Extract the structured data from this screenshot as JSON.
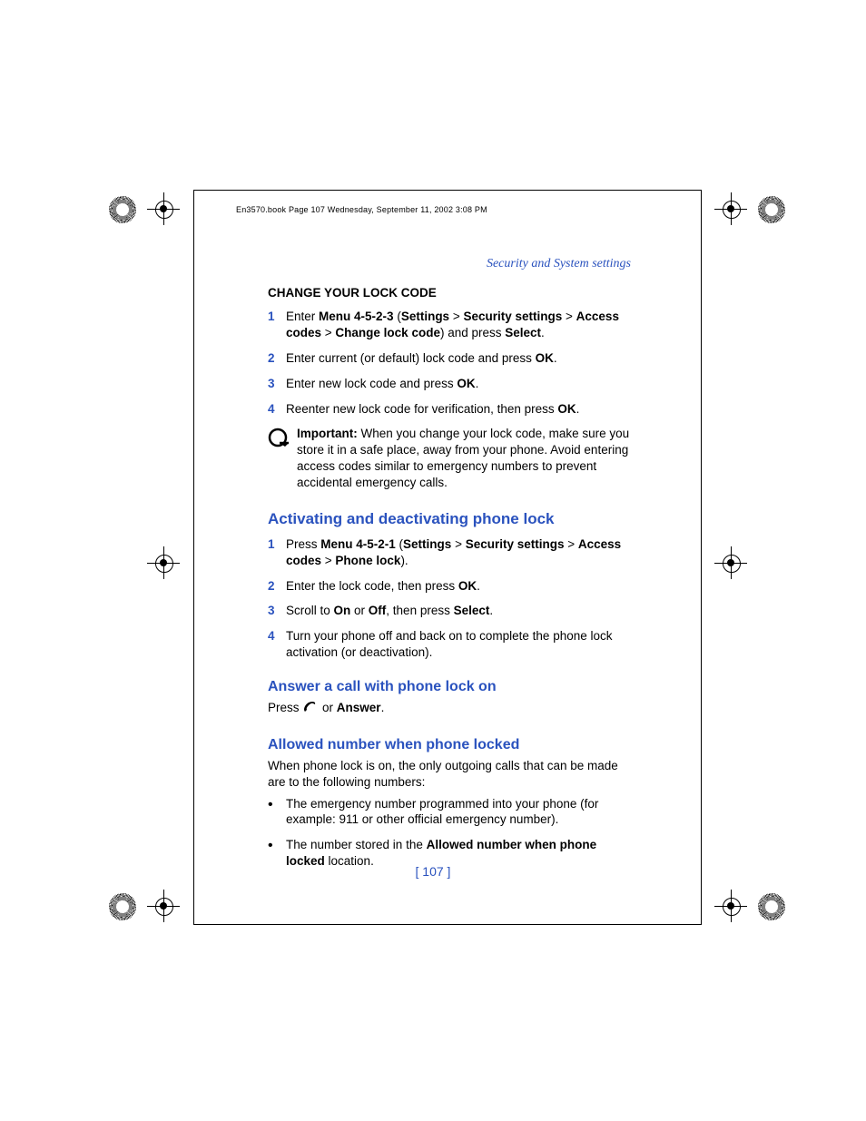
{
  "running_header": "En3570.book  Page 107  Wednesday, September 11, 2002  3:08 PM",
  "chapter": "Security and System settings",
  "section1_title": "CHANGE YOUR LOCK CODE",
  "s1": [
    {
      "n": "1",
      "pre": "Enter ",
      "b1": "Menu 4-5-2-3",
      "mid": " (",
      "b2": "Settings",
      "gt1": " > ",
      "b3": "Security settings",
      "gt2": " > ",
      "b4": "Access codes",
      "gt3": " > ",
      "b5": "Change lock code",
      "post": ") and press ",
      "b6": "Select",
      "end": "."
    },
    {
      "n": "2",
      "t1": "Enter current (or default) lock code and press ",
      "b": "OK",
      "t2": "."
    },
    {
      "n": "3",
      "t1": "Enter new lock code and press ",
      "b": "OK",
      "t2": "."
    },
    {
      "n": "4",
      "t1": "Reenter new lock code for verification, then press ",
      "b": "OK",
      "t2": "."
    }
  ],
  "important_label": "Important:",
  "important_body": " When you change your lock code, make sure you store it in a safe place, away from your phone. Avoid entering access codes similar to emergency numbers to prevent accidental emergency calls.",
  "section2_title": "Activating and deactivating phone lock",
  "s2": [
    {
      "n": "1",
      "pre": "Press ",
      "b1": "Menu 4-5-2-1",
      "mid": " (",
      "b2": "Settings",
      "gt1": " > ",
      "b3": "Security settings",
      "gt2": " > ",
      "b4": "Access codes",
      "gt3": " > ",
      "b5": "Phone lock",
      "post": ")."
    },
    {
      "n": "2",
      "t1": "Enter the lock code, then press ",
      "b": "OK",
      "t2": "."
    },
    {
      "n": "3",
      "t1": "Scroll to ",
      "b": "On",
      "t2": " or ",
      "b2": "Off",
      "t3": ", then press ",
      "b3": "Select",
      "t4": "."
    },
    {
      "n": "4",
      "t1": "Turn your phone off and back on to complete the phone lock activation (or deactivation)."
    }
  ],
  "section3_title": "Answer a call with phone lock on",
  "s3_press": "Press ",
  "s3_or": " or ",
  "s3_answer": "Answer",
  "s3_dot": ".",
  "section4_title": "Allowed number when phone locked",
  "s4_intro": "When phone lock is on, the only outgoing calls that can be made are to the following numbers:",
  "s4_b1": "The emergency number programmed into your phone (for example: 911 or other official emergency number).",
  "s4_b2_pre": "The number stored in the ",
  "s4_b2_bold": "Allowed number when phone locked",
  "s4_b2_post": " location.",
  "page_num": "[ 107 ]"
}
